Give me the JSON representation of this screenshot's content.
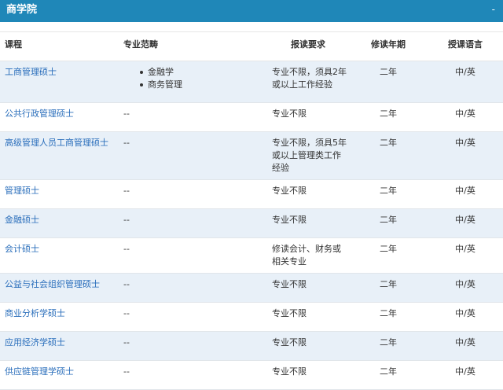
{
  "header": {
    "title": "商学院",
    "collapse_symbol": "-"
  },
  "table": {
    "columns": [
      "课程",
      "专业范畴",
      "报读要求",
      "修读年期",
      "授课语言"
    ],
    "rows": [
      {
        "course": "工商管理硕士",
        "scope": [
          "金融学",
          "商务管理"
        ],
        "requirement_lines": [
          "专业不限，须具2年",
          "或以上工作经验"
        ],
        "years": "二年",
        "language": "中/英"
      },
      {
        "course": "公共行政管理硕士",
        "scope_text": "--",
        "requirement_lines": [
          "专业不限"
        ],
        "years": "二年",
        "language": "中/英"
      },
      {
        "course": "高级管理人员工商管理硕士",
        "scope_text": "--",
        "requirement_lines": [
          "专业不限，须具5年",
          "或以上管理类工作",
          "经验"
        ],
        "years": "二年",
        "language": "中/英"
      },
      {
        "course": "管理硕士",
        "scope_text": "--",
        "requirement_lines": [
          "专业不限"
        ],
        "years": "二年",
        "language": "中/英"
      },
      {
        "course": "金融硕士",
        "scope_text": "--",
        "requirement_lines": [
          "专业不限"
        ],
        "years": "二年",
        "language": "中/英"
      },
      {
        "course": "会计硕士",
        "scope_text": "--",
        "requirement_lines": [
          "修读会计、财务或",
          "相关专业"
        ],
        "years": "二年",
        "language": "中/英"
      },
      {
        "course": "公益与社会组织管理硕士",
        "scope_text": "--",
        "requirement_lines": [
          "专业不限"
        ],
        "years": "二年",
        "language": "中/英"
      },
      {
        "course": "商业分析学硕士",
        "scope_text": "--",
        "requirement_lines": [
          "专业不限"
        ],
        "years": "二年",
        "language": "中/英"
      },
      {
        "course": "应用经济学硕士",
        "scope_text": "--",
        "requirement_lines": [
          "专业不限"
        ],
        "years": "二年",
        "language": "中/英"
      },
      {
        "course": "供应链管理学硕士",
        "scope_text": "--",
        "requirement_lines": [
          "专业不限"
        ],
        "years": "二年",
        "language": "中/英"
      }
    ]
  }
}
